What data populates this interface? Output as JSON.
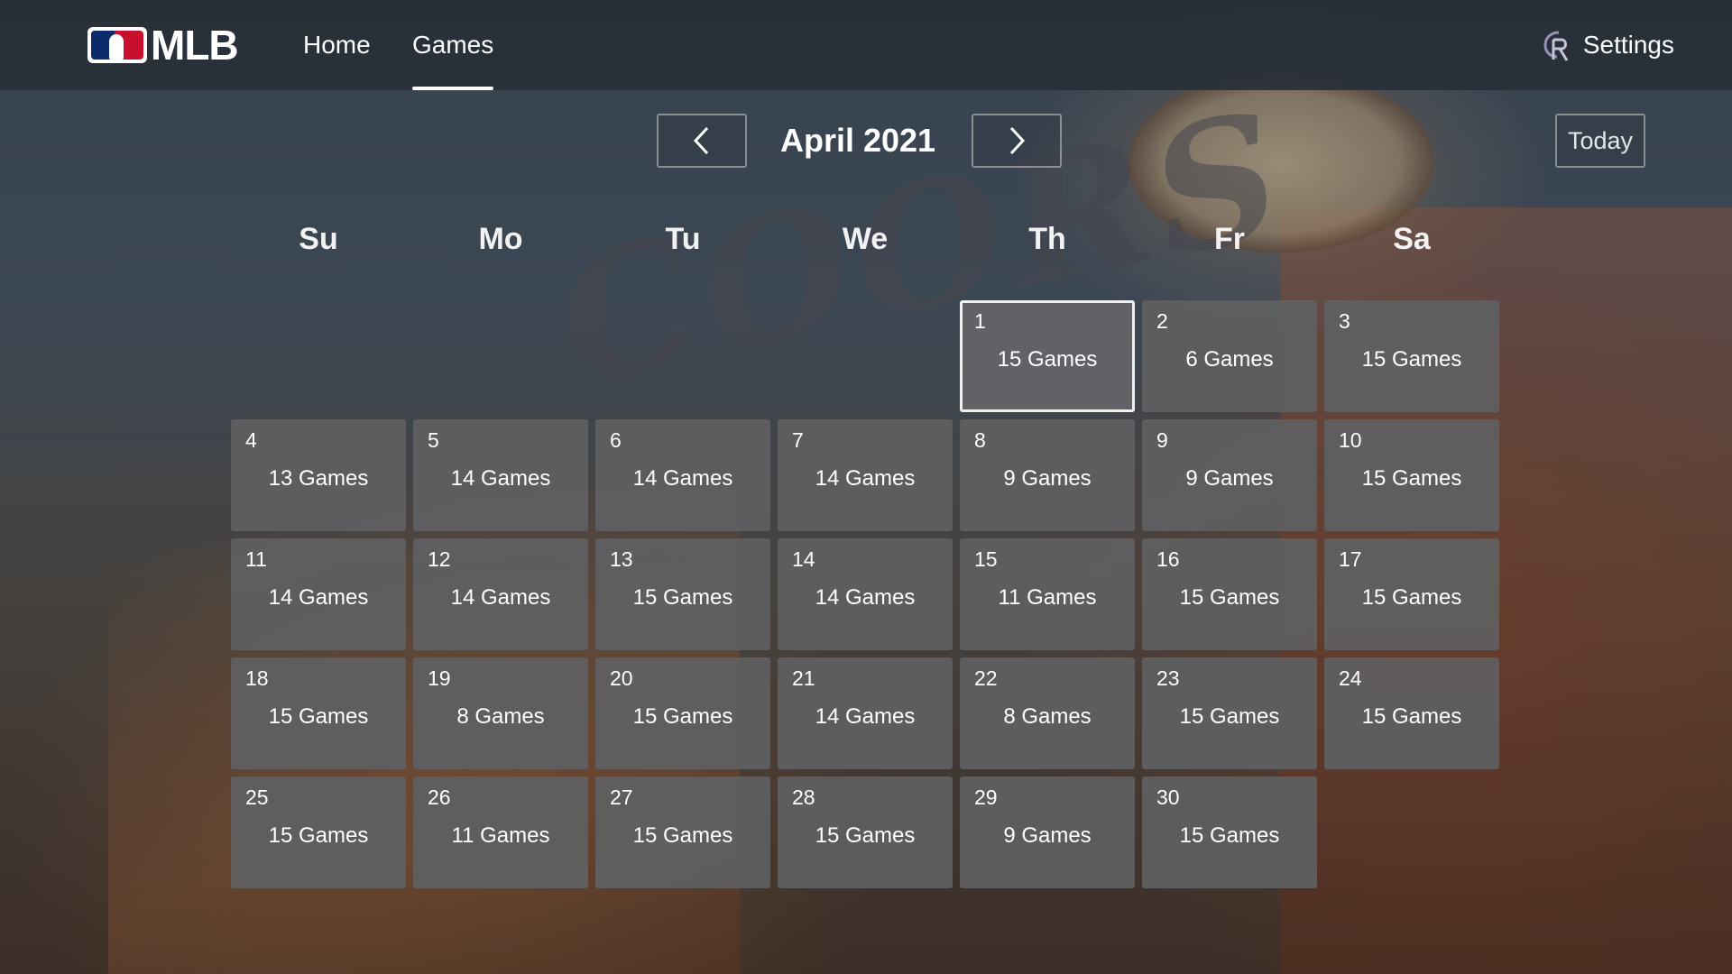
{
  "header": {
    "logo_text": "MLB",
    "nav": [
      {
        "label": "Home",
        "active": false
      },
      {
        "label": "Games",
        "active": true
      }
    ],
    "settings_label": "Settings",
    "team_icon": "rockies-cr-icon"
  },
  "calendar": {
    "month_title": "April 2021",
    "prev_icon": "chevron-left-icon",
    "next_icon": "chevron-right-icon",
    "today_label": "Today",
    "weekdays": [
      "Su",
      "Mo",
      "Tu",
      "We",
      "Th",
      "Fr",
      "Sa"
    ],
    "leading_empty_days": 4,
    "selected_day": "1",
    "days": [
      {
        "day": "1",
        "games": "15 Games"
      },
      {
        "day": "2",
        "games": "6 Games"
      },
      {
        "day": "3",
        "games": "15 Games"
      },
      {
        "day": "4",
        "games": "13 Games"
      },
      {
        "day": "5",
        "games": "14 Games"
      },
      {
        "day": "6",
        "games": "14 Games"
      },
      {
        "day": "7",
        "games": "14 Games"
      },
      {
        "day": "8",
        "games": "9 Games"
      },
      {
        "day": "9",
        "games": "9 Games"
      },
      {
        "day": "10",
        "games": "15 Games"
      },
      {
        "day": "11",
        "games": "14 Games"
      },
      {
        "day": "12",
        "games": "14 Games"
      },
      {
        "day": "13",
        "games": "15 Games"
      },
      {
        "day": "14",
        "games": "14 Games"
      },
      {
        "day": "15",
        "games": "11 Games"
      },
      {
        "day": "16",
        "games": "15 Games"
      },
      {
        "day": "17",
        "games": "15 Games"
      },
      {
        "day": "18",
        "games": "15 Games"
      },
      {
        "day": "19",
        "games": "8 Games"
      },
      {
        "day": "20",
        "games": "15 Games"
      },
      {
        "day": "21",
        "games": "14 Games"
      },
      {
        "day": "22",
        "games": "8 Games"
      },
      {
        "day": "23",
        "games": "15 Games"
      },
      {
        "day": "24",
        "games": "15 Games"
      },
      {
        "day": "25",
        "games": "15 Games"
      },
      {
        "day": "26",
        "games": "11 Games"
      },
      {
        "day": "27",
        "games": "15 Games"
      },
      {
        "day": "28",
        "games": "15 Games"
      },
      {
        "day": "29",
        "games": "9 Games"
      },
      {
        "day": "30",
        "games": "15 Games"
      }
    ]
  },
  "background": {
    "sign_text": "COORS"
  }
}
